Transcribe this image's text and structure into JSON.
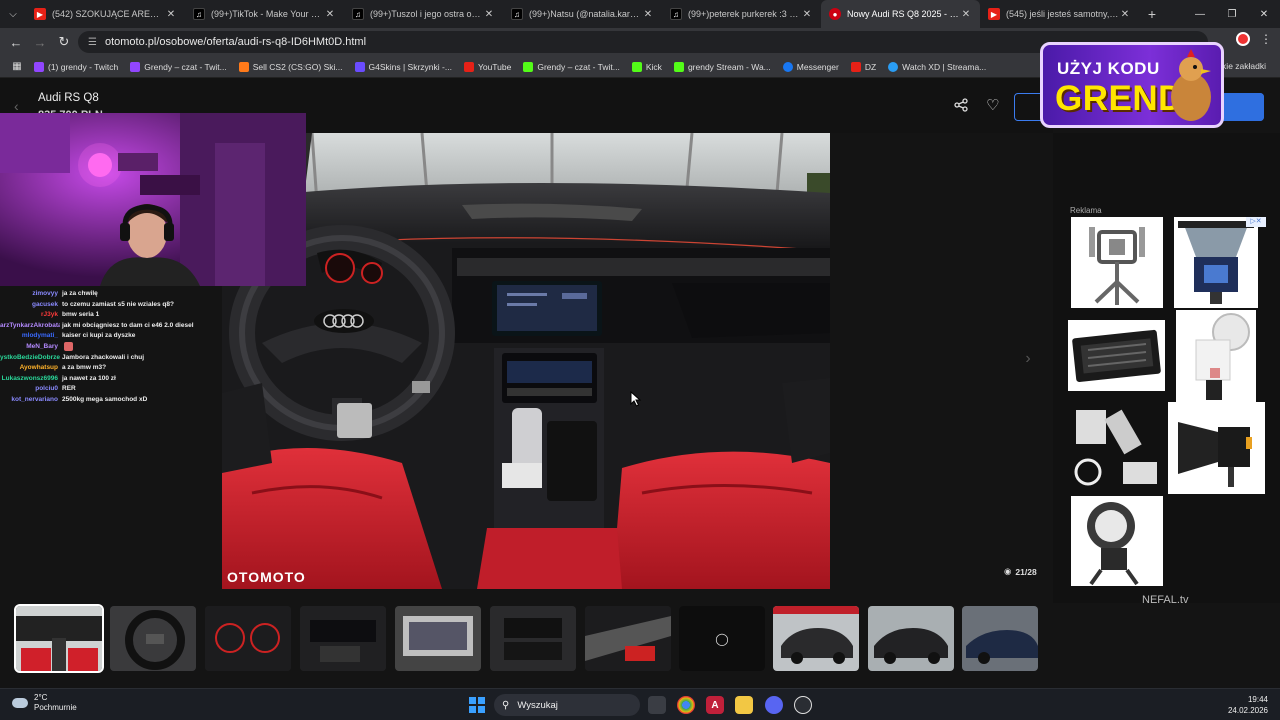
{
  "tabs": [
    {
      "label": "(542) SZOKUJĄCE ARESZTOWA...",
      "icon": "youtube-icon",
      "active": false
    },
    {
      "label": "(99+)TikTok - Make Your Day",
      "icon": "tiktok-icon",
      "active": false
    },
    {
      "label": "(99+)Tuszol i jego ostra odpow...",
      "icon": "tiktok-icon",
      "active": false
    },
    {
      "label": "(99+)Natsu (@natalia.karczmar...",
      "icon": "tiktok-icon",
      "active": false
    },
    {
      "label": "(99+)peterek purkerek :3 #pete...",
      "icon": "tiktok-icon",
      "active": false
    },
    {
      "label": "Nowy Audi RS Q8 2025 - 835 7...",
      "icon": "audi-icon",
      "active": true
    },
    {
      "label": "(545) jeśli jesteś samotny, ten fi...",
      "icon": "youtube-icon",
      "active": false
    }
  ],
  "address": {
    "url": "otomoto.pl/osobowe/oferta/audi-rs-q8-ID6HMt0D.html"
  },
  "bookmarks": [
    {
      "label": "(1) grendy - Twitch",
      "color": "#9146ff"
    },
    {
      "label": "Grendy – czat - Twit...",
      "color": "#9146ff"
    },
    {
      "label": "Sell CS2 (CS:GO) Ski...",
      "color": "#ff7a1a"
    },
    {
      "label": "G4Skins | Skrzynki -...",
      "color": "#6a4cff"
    },
    {
      "label": "YouTube",
      "color": "#e62117"
    },
    {
      "label": "Grendy – czat - Twit...",
      "color": "#53fc18"
    },
    {
      "label": "Kick",
      "color": "#53fc18"
    },
    {
      "label": "grendy Stream - Wa...",
      "color": "#53fc18"
    },
    {
      "label": "Messenger",
      "color": "#1877f2"
    },
    {
      "label": "DZ",
      "color": "#e62117"
    },
    {
      "label": "Watch XD | Streama...",
      "color": "#2a9df4"
    }
  ],
  "bookmarks_right": "tkie zakładki",
  "listing": {
    "title": "Audi RS Q8",
    "price": "835 700 PLN",
    "photo_watermark": "OTOMOTO",
    "photo_counter": "21/28"
  },
  "ad": {
    "label": "Reklama"
  },
  "overlay": {
    "promo_line1": "UŻYJ KODU",
    "promo_line2": "GRENDY",
    "watermark": "NEFAL.tv"
  },
  "chat": [
    {
      "user": "zimovyy",
      "msg": "ja za chwilę",
      "color": "#8a8aff"
    },
    {
      "user": "gacusek",
      "msg": "to czemu zamiast s5 nie wziales q8?",
      "color": "#8a8aff"
    },
    {
      "user": "rJ3yk",
      "msg": "bmw seria 1",
      "color": "#ff3a3a"
    },
    {
      "user": "arzTynkarzAkrobata",
      "msg": "jak mi obciągniesz to dam ci e46 2.0 diesel",
      "color": "#b48aff"
    },
    {
      "user": "mlodymati_",
      "msg": "kaiser ci kupi za dyszke",
      "color": "#3a6aff"
    },
    {
      "user": "MeN_Bary",
      "msg": "",
      "color": "#b48aff"
    },
    {
      "user": "ystkoBedzieDobrze",
      "msg": "Jambora zhackowali i chuj",
      "color": "#2ad89a"
    },
    {
      "user": "Ayowhatsup",
      "msg": "a za bmw m3?",
      "color": "#ffb22a"
    },
    {
      "user": "Lukaszwonsz6996",
      "msg": "ja nawet za 100 zł",
      "color": "#2ad89a"
    },
    {
      "user": "polciu0",
      "msg": "RER",
      "color": "#8a8aff"
    },
    {
      "user": "kot_nervariano",
      "msg": "2500kg mega samochod xD",
      "color": "#8a8aff"
    }
  ],
  "taskbar": {
    "weather_temp": "2°C",
    "weather_desc": "Pochmurnie",
    "search_placeholder": "Wyszukaj",
    "time": "19:44",
    "date": "24.02.2026"
  }
}
